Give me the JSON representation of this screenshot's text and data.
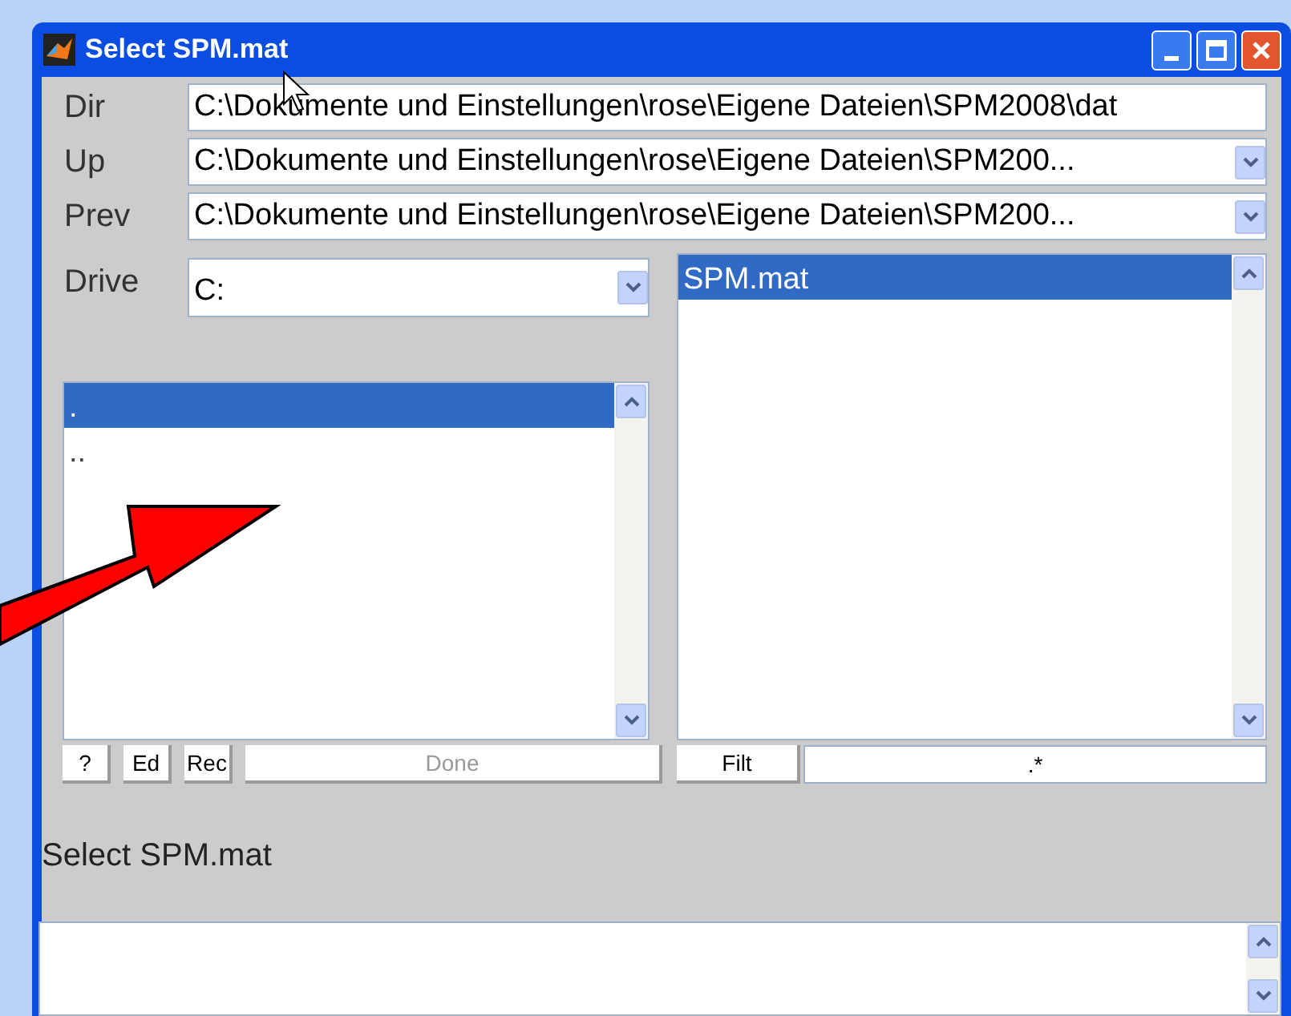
{
  "window": {
    "title": "Select SPM.mat"
  },
  "path_rows": [
    {
      "label": "Dir",
      "value": "C:\\Dokumente und Einstellungen\\rose\\Eigene Dateien\\SPM2008\\dat",
      "kind": "text"
    },
    {
      "label": "Up",
      "value": "C:\\Dokumente und Einstellungen\\rose\\Eigene Dateien\\SPM200...",
      "kind": "dropdown"
    },
    {
      "label": "Prev",
      "value": "C:\\Dokumente und Einstellungen\\rose\\Eigene Dateien\\SPM200...",
      "kind": "dropdown"
    }
  ],
  "drive": {
    "label": "Drive",
    "value": "C:"
  },
  "directory_list": {
    "items": [
      {
        "text": ".",
        "selected": true
      },
      {
        "text": "..",
        "selected": false
      }
    ]
  },
  "file_list": {
    "items": [
      {
        "text": "SPM.mat",
        "selected": true
      }
    ]
  },
  "buttons": [
    {
      "label": "?",
      "disabled": false
    },
    {
      "label": "Ed",
      "disabled": false
    },
    {
      "label": "Rec",
      "disabled": false
    },
    {
      "label": "Done",
      "disabled": true
    }
  ],
  "filter": {
    "button": "Filt",
    "value": ".*"
  },
  "prompt": "Select SPM.mat"
}
